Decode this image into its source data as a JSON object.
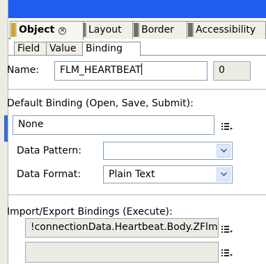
{
  "outer_tabs": [
    {
      "label": "Object",
      "active": true
    },
    {
      "label": "Layout",
      "active": false
    },
    {
      "label": "Border",
      "active": false
    },
    {
      "label": "Accessibility",
      "active": false
    }
  ],
  "inner_tabs": [
    {
      "label": "Field",
      "active": false
    },
    {
      "label": "Value",
      "active": false
    },
    {
      "label": "Binding",
      "active": true
    }
  ],
  "name": {
    "label": "Name:",
    "value": "FLM_HEARTBEAT",
    "index": "0"
  },
  "default_binding": {
    "label": "Default Binding (Open, Save, Submit):",
    "value": "None",
    "icon": "list-binding-icon"
  },
  "data_pattern": {
    "label": "Data Pattern:",
    "value": ""
  },
  "data_format": {
    "label": "Data Format:",
    "value": "Plain Text"
  },
  "import_export": {
    "label": "Import/Export Bindings (Execute):",
    "rows": [
      {
        "value": "!connectionData.Heartbeat.Body.ZFlmI"
      },
      {
        "value": ""
      }
    ]
  },
  "colors": {
    "title_bar": "#1f5cf0",
    "tab_bg": "#f1f0e8",
    "field_border": "#7f9db9"
  }
}
